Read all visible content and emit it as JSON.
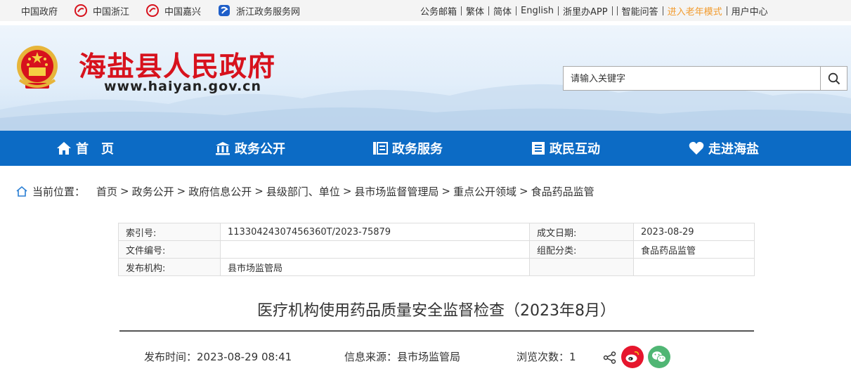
{
  "topbar": {
    "links": [
      "中国政府",
      "中国浙江",
      "中国嘉兴",
      "浙江政务服务网"
    ],
    "right": [
      "公务邮箱",
      "繁体",
      "简体",
      "English",
      "浙里办APP",
      "智能问答",
      "进入老年模式",
      "用户中心"
    ]
  },
  "header": {
    "title": "海盐县人民政府",
    "url": "www.haiyan.gov.cn",
    "search_placeholder": "请输入关键字"
  },
  "nav": [
    "首　页",
    "政务公开",
    "政务服务",
    "政民互动",
    "走进海盐"
  ],
  "breadcrumb": {
    "label": "当前位置：",
    "items": [
      "首页",
      "政务公开",
      "政府信息公开",
      "县级部门、单位",
      "县市场监督管理局",
      "重点公开领域",
      "食品药品监管"
    ]
  },
  "info": {
    "index_label": "索引号:",
    "index_value": "11330424307456360T/2023-75879",
    "date_label": "成文日期:",
    "date_value": "2023-08-29",
    "doc_no_label": "文件编号:",
    "doc_no_value": "",
    "category_label": "组配分类:",
    "category_value": "食品药品监管",
    "publisher_label": "发布机构:",
    "publisher_value": "县市场监管局"
  },
  "article": {
    "title": "医疗机构使用药品质量安全监督检查（2023年8月）",
    "publish_time": "发布时间：2023-08-29 08:41",
    "source": "信息来源：县市场监管局",
    "views": "浏览次数：1"
  },
  "colors": {
    "nav": "#0c6bc5",
    "title": "#d7121d",
    "elder": "#f29b2e"
  }
}
